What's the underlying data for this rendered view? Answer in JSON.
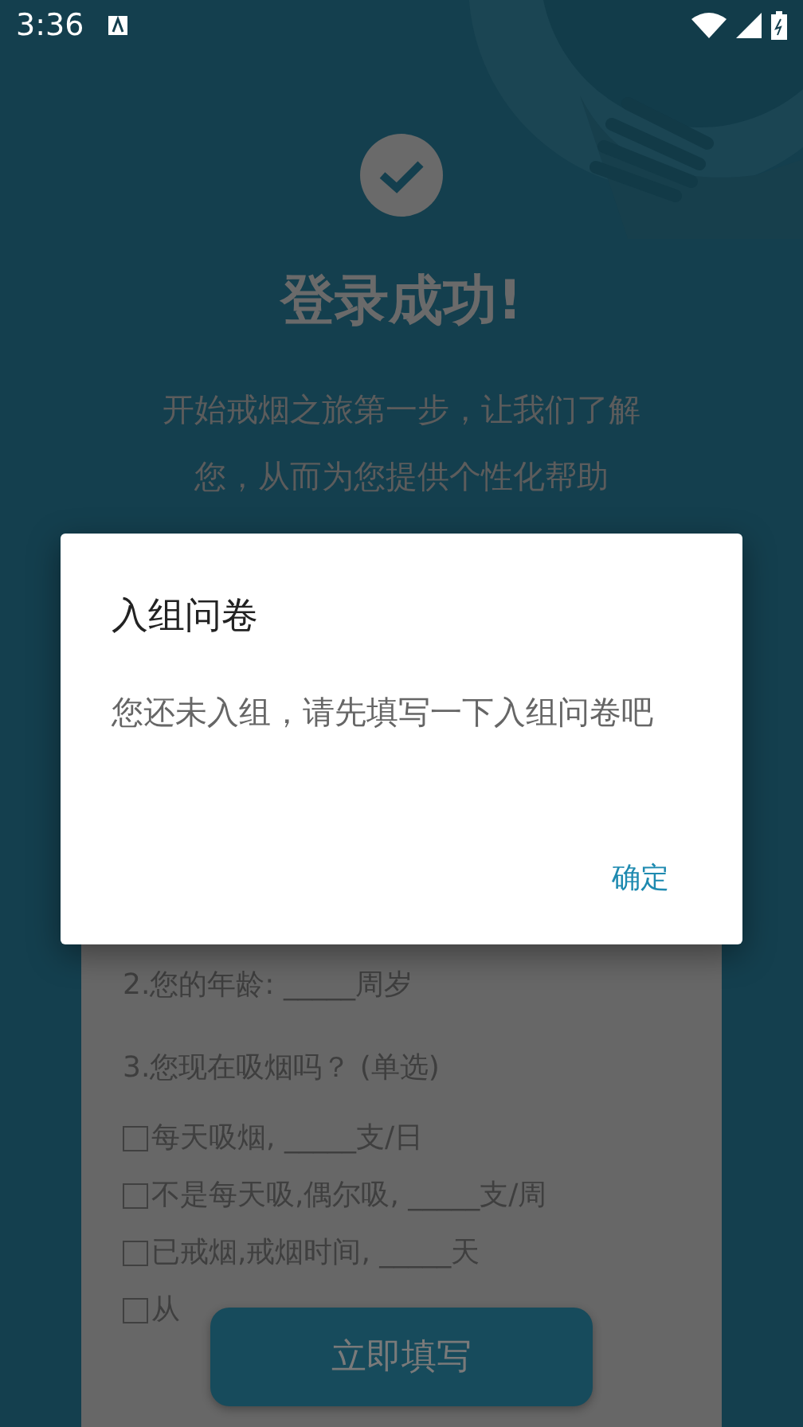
{
  "status_bar": {
    "time": "3:36"
  },
  "header": {
    "title": "登录成功!",
    "subtitle": "开始戒烟之旅第一步，让我们了解您，从而为您提供个性化帮助"
  },
  "questionnaire": {
    "questions": [
      {
        "text": "2.您的年龄: _____周岁"
      },
      {
        "text": "3.您现在吸烟吗？ (单选)",
        "options": [
          {
            "label": "每天吸烟, _____支/日",
            "checked": false
          },
          {
            "label": "不是每天吸,偶尔吸, _____支/周",
            "checked": false
          },
          {
            "label": "已戒烟,戒烟时间, _____天",
            "checked": false
          },
          {
            "label": "从",
            "checked": false
          }
        ]
      }
    ]
  },
  "fill_button": {
    "label": "立即填写"
  },
  "dialog": {
    "title": "入组问卷",
    "message": "您还未入组，请先填写一下入组问卷吧",
    "button": "确定"
  }
}
